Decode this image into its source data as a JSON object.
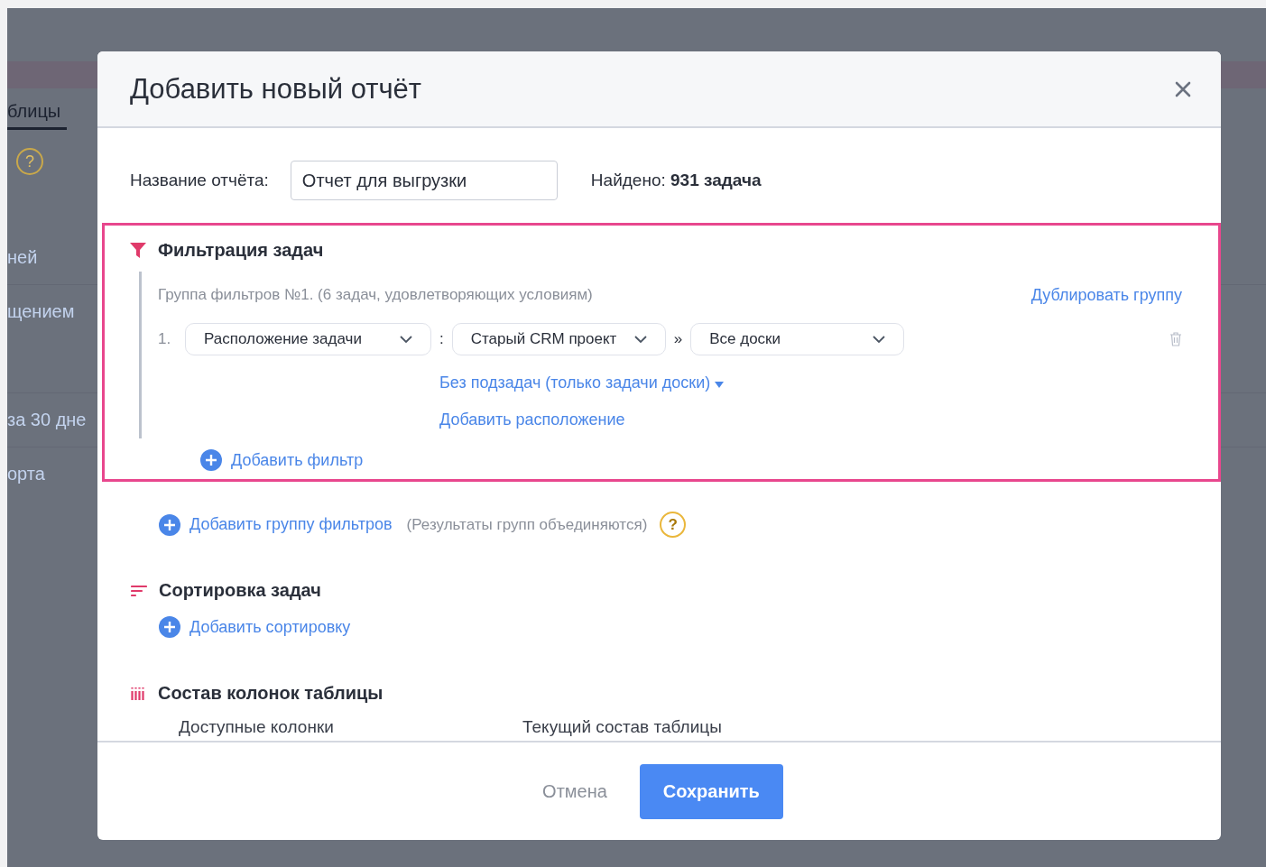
{
  "background": {
    "tab": "блицы",
    "help": "?",
    "items": [
      "ней",
      "щением",
      "за 30 дне",
      "орта"
    ]
  },
  "dialog": {
    "title": "Добавить новый отчёт",
    "name_label": "Название отчёта:",
    "name_value": "Отчет для выгрузки",
    "found": "Найдено: **931 задача**",
    "filters": {
      "title": "Фильтрация задач",
      "highlighted": true,
      "group": {
        "caption": "Группа фильтров №1. (6 задач, удовлетворяющих условиям)",
        "duplicate": "Дублировать группу",
        "conditions": [
          {
            "number": "1.",
            "parts": [
              {
                "kind": "select",
                "text": "Расположение задачи"
              },
              {
                "kind": "separator",
                "text": ":"
              },
              {
                "kind": "select",
                "text": "Старый CRM проект"
              },
              {
                "kind": "separator",
                "text": "»"
              },
              {
                "kind": "select",
                "text": "Все доски"
              }
            ],
            "subtasks": "Без подзадач (только задачи доски)",
            "add_location": "Добавить расположение"
          }
        ]
      },
      "add_filter": "Добавить фильтр"
    },
    "add_group": "Добавить группу фильтров",
    "add_group_note": "(Результаты групп объединяются)",
    "help": "?",
    "sorting": {
      "title": "Сортировка задач",
      "add": "Добавить сортировку"
    },
    "columns": {
      "title": "Состав колонок таблицы",
      "available": "Доступные колонки",
      "current": "Текущий состав таблицы"
    },
    "buttons": [
      {
        "kind": "cancel",
        "label": "Отмена"
      },
      {
        "kind": "primary",
        "label": "Сохранить"
      }
    ]
  }
}
